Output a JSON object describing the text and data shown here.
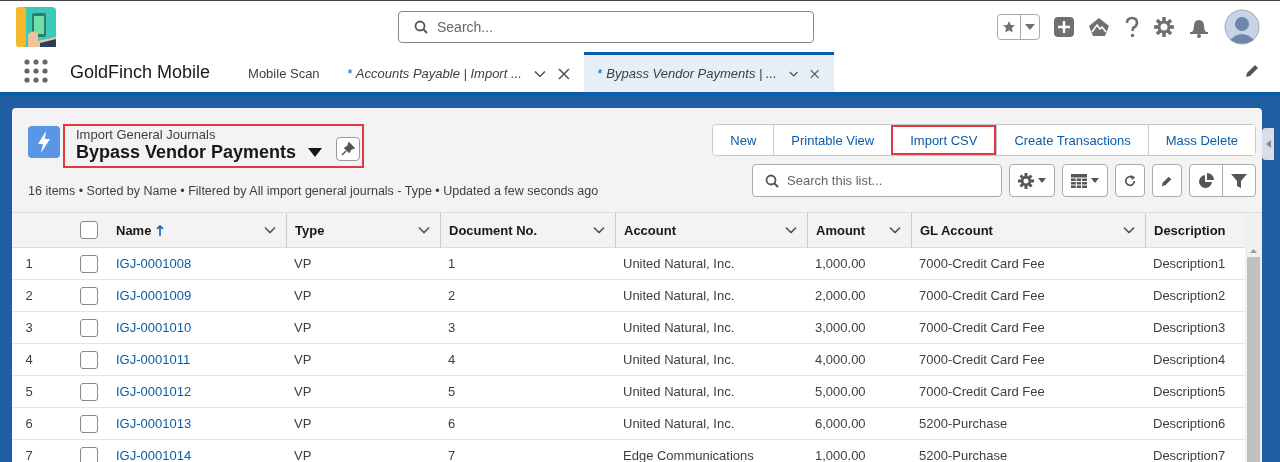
{
  "global_search": {
    "placeholder": "Search..."
  },
  "app": {
    "name": "GoldFinch Mobile"
  },
  "tabs": [
    {
      "label": "Mobile Scan",
      "selected": false,
      "closable": false
    },
    {
      "prefix": "*",
      "label": "Accounts Payable | Import ...",
      "selected": false,
      "closable": true
    },
    {
      "prefix": "*",
      "label": "Bypass Vendor Payments | ...",
      "selected": true,
      "closable": true
    }
  ],
  "list_view": {
    "object": "Import General Journals",
    "title": "Bypass Vendor Payments",
    "highlighted": true,
    "status": "16 items • Sorted by Name • Filtered by All import general journals - Type • Updated a few seconds ago",
    "search_placeholder": "Search this list...",
    "actions": [
      {
        "label": "New",
        "highlighted": false
      },
      {
        "label": "Printable View",
        "highlighted": false
      },
      {
        "label": "Import CSV",
        "highlighted": true
      },
      {
        "label": "Create Transactions",
        "highlighted": false
      },
      {
        "label": "Mass Delete",
        "highlighted": false
      }
    ]
  },
  "table": {
    "select_all_checked": false,
    "columns": [
      {
        "label": "Name",
        "kind": "link",
        "sorted": true,
        "menu": true
      },
      {
        "label": "Type",
        "kind": "text",
        "sorted": false,
        "menu": true
      },
      {
        "label": "Document No.",
        "kind": "text",
        "sorted": false,
        "menu": true
      },
      {
        "label": "Account",
        "kind": "text",
        "sorted": false,
        "menu": true
      },
      {
        "label": "Amount",
        "kind": "text",
        "sorted": false,
        "menu": true
      },
      {
        "label": "GL Account",
        "kind": "text",
        "sorted": false,
        "menu": true
      },
      {
        "label": "Description",
        "kind": "text",
        "sorted": false,
        "menu": false
      }
    ],
    "rows": [
      {
        "number": "1",
        "checked": false,
        "cells": [
          "IGJ-0001008",
          "VP",
          "1",
          "United Natural, Inc.",
          "1,000.00",
          "7000-Credit Card Fee",
          "Description1"
        ]
      },
      {
        "number": "2",
        "checked": false,
        "cells": [
          "IGJ-0001009",
          "VP",
          "2",
          "United Natural, Inc.",
          "2,000.00",
          "7000-Credit Card Fee",
          "Description2"
        ]
      },
      {
        "number": "3",
        "checked": false,
        "cells": [
          "IGJ-0001010",
          "VP",
          "3",
          "United Natural, Inc.",
          "3,000.00",
          "7000-Credit Card Fee",
          "Description3"
        ]
      },
      {
        "number": "4",
        "checked": false,
        "cells": [
          "IGJ-0001011",
          "VP",
          "4",
          "United Natural, Inc.",
          "4,000.00",
          "7000-Credit Card Fee",
          "Description4"
        ]
      },
      {
        "number": "5",
        "checked": false,
        "cells": [
          "IGJ-0001012",
          "VP",
          "5",
          "United Natural, Inc.",
          "5,000.00",
          "7000-Credit Card Fee",
          "Description5"
        ]
      },
      {
        "number": "6",
        "checked": false,
        "cells": [
          "IGJ-0001013",
          "VP",
          "6",
          "United Natural, Inc.",
          "6,000.00",
          "5200-Purchase",
          "Description6"
        ]
      },
      {
        "number": "7",
        "checked": false,
        "cells": [
          "IGJ-0001014",
          "VP",
          "7",
          "Edge Communications",
          "1,000.00",
          "5200-Purchase",
          "Description7"
        ]
      }
    ]
  }
}
